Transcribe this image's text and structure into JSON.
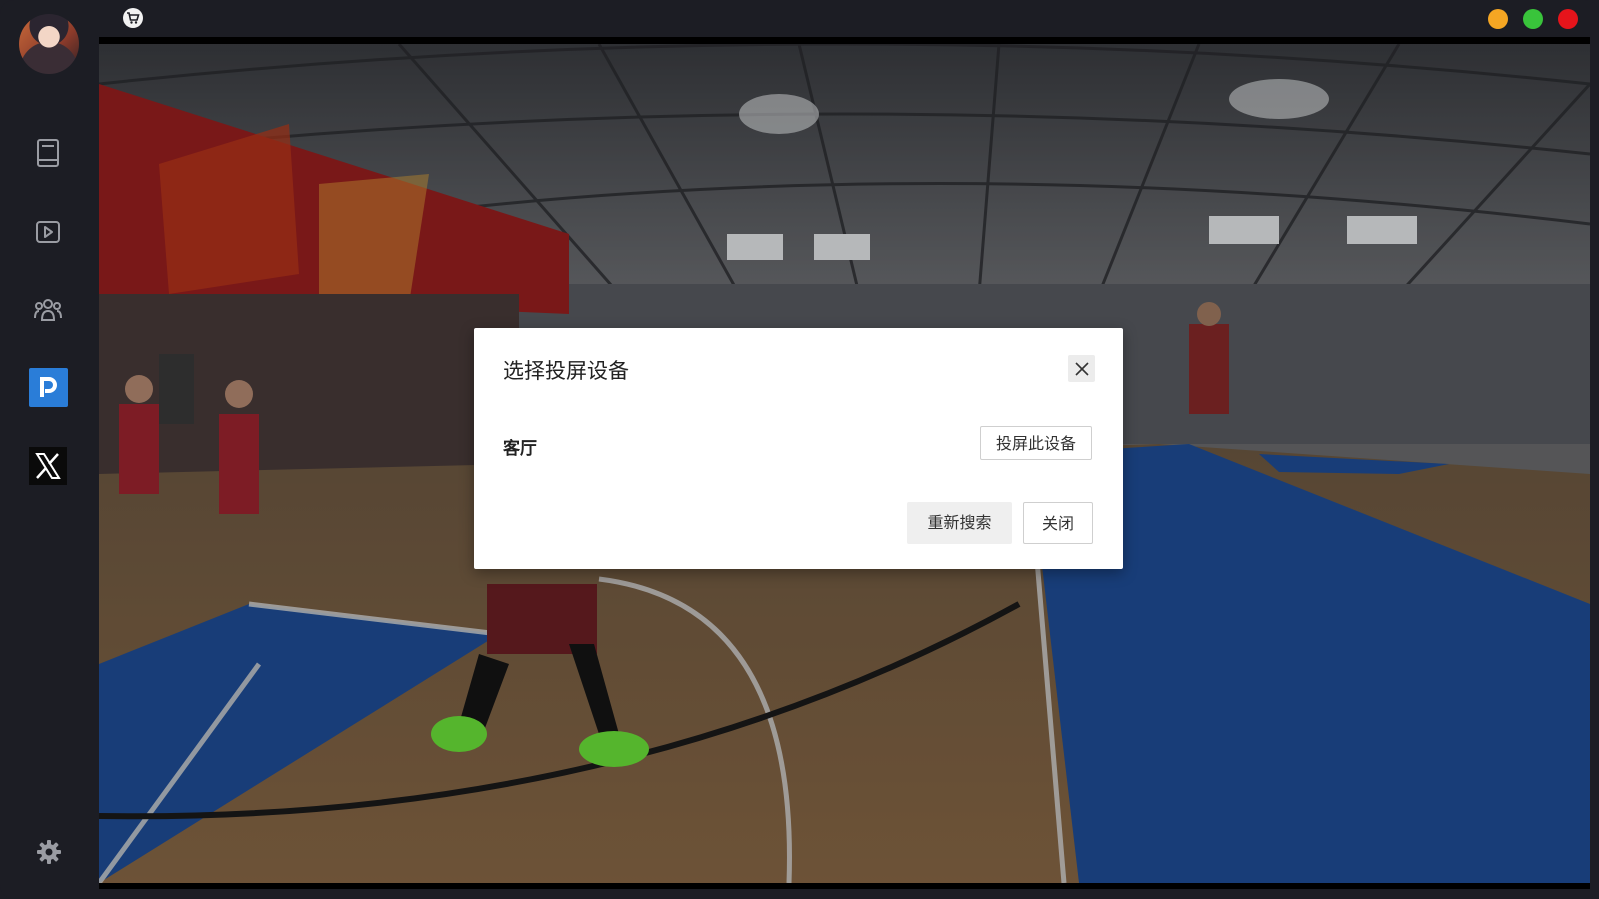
{
  "topbar": {
    "cart_icon": "cart-icon",
    "window_buttons": [
      {
        "name": "minimize-button",
        "color": "#f5a623"
      },
      {
        "name": "maximize-button",
        "color": "#39c43b"
      },
      {
        "name": "close-window-button",
        "color": "#e6141b"
      }
    ]
  },
  "sidebar": {
    "items": [
      {
        "name": "sidebar-item-book",
        "icon": "book-icon"
      },
      {
        "name": "sidebar-item-video",
        "icon": "play-icon"
      },
      {
        "name": "sidebar-item-community",
        "icon": "group-icon"
      },
      {
        "name": "sidebar-item-p-app",
        "icon": "p-logo-icon",
        "color": "#2a7dd8"
      },
      {
        "name": "sidebar-item-x",
        "icon": "x-logo-icon"
      }
    ],
    "settings_icon": "gear-icon"
  },
  "dialog": {
    "title": "选择投屏设备",
    "devices": [
      {
        "name": "客厅",
        "action_label": "投屏此设备"
      }
    ],
    "research_label": "重新搜索",
    "close_label": "关闭"
  }
}
